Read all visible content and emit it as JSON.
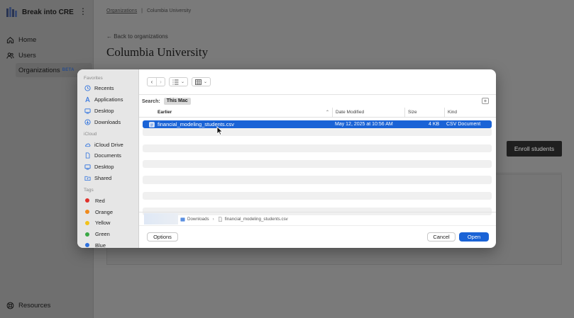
{
  "app": {
    "brand_name": "Break into CRE",
    "nav": [
      {
        "label": "Home",
        "icon": "home-icon"
      },
      {
        "label": "Users",
        "icon": "users-icon"
      }
    ],
    "nav_sub": {
      "label": "Organizations",
      "badge": "BETA"
    },
    "resources_label": "Resources"
  },
  "page": {
    "breadcrumb": {
      "link": "Organizations",
      "separator": "|",
      "current": "Columbia University"
    },
    "back_label": "← Back to organizations",
    "title": "Columbia University",
    "enroll_button": "Enroll students"
  },
  "dialog": {
    "sidebar": {
      "favorites_heading": "Favorites",
      "favorites": [
        {
          "label": "Recents",
          "icon": "clock-icon"
        },
        {
          "label": "Applications",
          "icon": "applications-icon"
        },
        {
          "label": "Desktop",
          "icon": "desktop-icon"
        },
        {
          "label": "Downloads",
          "icon": "download-icon"
        }
      ],
      "icloud_heading": "iCloud",
      "icloud": [
        {
          "label": "iCloud Drive",
          "icon": "cloud-icon"
        },
        {
          "label": "Documents",
          "icon": "document-icon"
        },
        {
          "label": "Desktop",
          "icon": "desktop-icon"
        },
        {
          "label": "Shared",
          "icon": "shared-folder-icon"
        }
      ],
      "tags_heading": "Tags",
      "tags": [
        {
          "label": "Red",
          "color": "#e0312b"
        },
        {
          "label": "Orange",
          "color": "#f08a1c"
        },
        {
          "label": "Yellow",
          "color": "#f2c21b"
        },
        {
          "label": "Green",
          "color": "#3aa845"
        },
        {
          "label": "Blue",
          "color": "#2f72de"
        }
      ]
    },
    "search": {
      "label": "Search:",
      "scope": "This Mac",
      "add_label": "+"
    },
    "columns": {
      "name": "Earlier",
      "date": "Date Modified",
      "size": "Size",
      "kind": "Kind"
    },
    "selected_file": {
      "name": "financial_modeling_students.csv",
      "date": "May 12, 2025 at 10:56 AM",
      "size": "4 KB",
      "kind": "CSV Document"
    },
    "path": {
      "folder": "Downloads",
      "arrow": "›",
      "file": "financial_modeling_students.csv"
    },
    "buttons": {
      "options": "Options",
      "cancel": "Cancel",
      "open": "Open"
    },
    "accent_color": "#1a63d6"
  }
}
